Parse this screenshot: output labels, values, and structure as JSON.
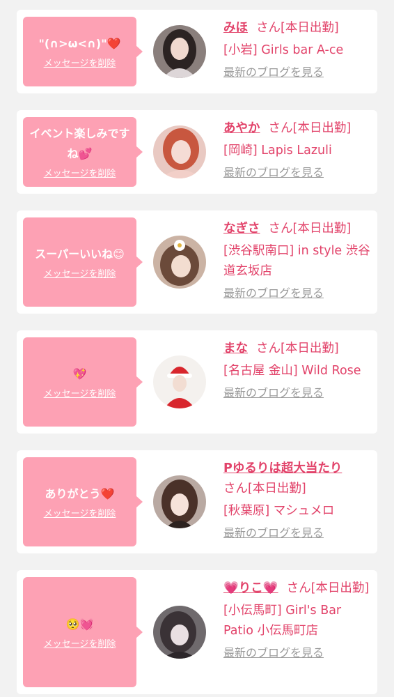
{
  "cards": [
    {
      "message": "\"(∩>ω<∩)\"",
      "emoji": "❤️",
      "delete_label": "メッセージを削除",
      "name": "みほ",
      "suffix": "さん[本日出勤]",
      "shop": "[小岩] Girls bar A-ce",
      "blog_label": "最新のブログを見る"
    },
    {
      "message": "イベント楽しみですね",
      "emoji": "💕",
      "delete_label": "メッセージを削除",
      "name": "あやか",
      "suffix": "さん[本日出勤]",
      "shop": "[岡崎] Lapis Lazuli",
      "blog_label": "最新のブログを見る"
    },
    {
      "message": "スーパーいいね",
      "emoji": "😊",
      "delete_label": "メッセージを削除",
      "name": "なぎさ",
      "suffix": "さん[本日出勤]",
      "shop": "[渋谷駅南口] in style 渋谷道玄坂店",
      "blog_label": "最新のブログを見る"
    },
    {
      "message": "",
      "emoji": "💖",
      "delete_label": "メッセージを削除",
      "name": "まな",
      "suffix": "さん[本日出勤]",
      "shop": "[名古屋 金山] Wild Rose",
      "blog_label": "最新のブログを見る"
    },
    {
      "message": "ありがとう",
      "emoji": "❤️",
      "delete_label": "メッセージを削除",
      "name": "Pゆるりは超大当たり",
      "suffix": "さん[本日出勤]",
      "shop": "[秋葉原] マシュメロ",
      "blog_label": "最新のブログを見る"
    },
    {
      "message": "",
      "emoji": "🥺💓",
      "delete_label": "メッセージを削除",
      "name_prefix": "💗",
      "name": "りこ",
      "name_suffix": "💗",
      "suffix": "さん[本日出勤]",
      "shop": "[小伝馬町] Girl's Bar Patio 小伝馬町店",
      "blog_label": "最新のブログを見る"
    }
  ],
  "colors": {
    "bubble": "#fda1b4",
    "accent": "#e2436a",
    "muted": "#9a9a9a",
    "background": "#f2f2f2"
  }
}
